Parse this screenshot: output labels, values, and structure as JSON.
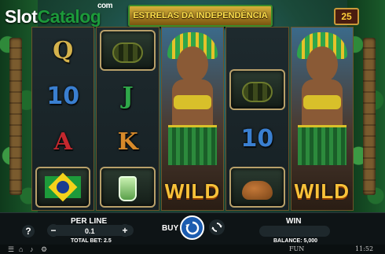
{
  "logo": {
    "part1": "Slot",
    "part2": "Catalog",
    "suffix": "com"
  },
  "game": {
    "title": "ESTRELAS DA INDEPENDÊNCIA",
    "lines": "25"
  },
  "reels": [
    [
      "Q",
      "10",
      "A",
      "flag"
    ],
    [
      "snake",
      "J",
      "K",
      "caipirinha"
    ],
    [
      "wild",
      "wild",
      "wild",
      "wild"
    ],
    [
      "snake",
      "10",
      "capybara"
    ],
    [
      "wild",
      "wild",
      "wild",
      "wild"
    ]
  ],
  "symbols": {
    "q": "Q",
    "ten": "10",
    "a": "A",
    "j": "J",
    "k": "K",
    "wild": "WILD"
  },
  "controls": {
    "help": "?",
    "per_line_label": "PER LINE",
    "per_line_value": "0.1",
    "minus": "−",
    "plus": "+",
    "total_bet_label": "TOTAL BET:",
    "total_bet_value": "2.5",
    "buy": "BUY",
    "win_label": "WIN",
    "balance_label": "BALANCE:",
    "balance_value": "5,000"
  },
  "footer": {
    "mode": "FUN",
    "time": "11:52"
  },
  "colors": {
    "accent_gold": "#f7c23a",
    "spin_blue": "#1c5cb0",
    "brand_green": "#1c9a3a"
  }
}
